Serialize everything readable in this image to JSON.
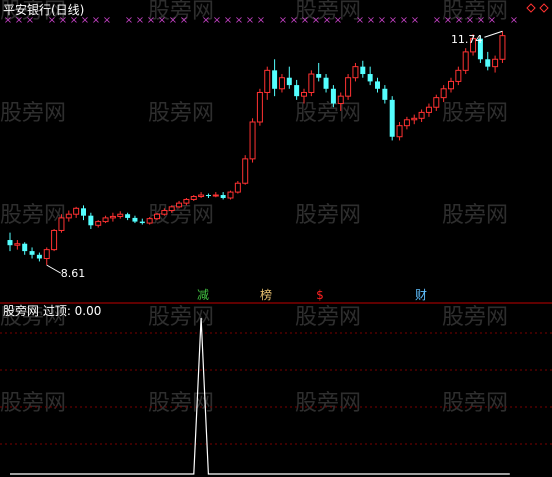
{
  "colors": {
    "background": "#000000",
    "up_candle": "#ff3232",
    "down_candle": "#54ffff",
    "doji": "#ffffff",
    "marker_x": "#c040c0",
    "title_text": "#ffffff",
    "divider": "#c00000",
    "grid": "#7a0000",
    "watermark": "#555555",
    "label_jian": "#40c040",
    "label_bang": "#e8c070",
    "label_s": "#ff2020",
    "label_cai": "#60c0ff",
    "indicator_line": "#ffffff"
  },
  "watermarks": [
    "股旁网",
    "股旁网",
    "股旁网",
    "股旁网",
    "股旁网",
    "股旁网",
    "股旁网",
    "股旁网",
    "股旁网",
    "股旁网",
    "股旁网",
    "股旁网",
    "股旁网",
    "股旁网",
    "股旁网",
    "股旁网",
    "股旁网",
    "股旁网",
    "股旁网",
    "股旁网",
    "股旁网",
    "股旁网",
    "股旁网",
    "股旁网",
    "股旁网",
    "股旁网",
    "股旁网",
    "股旁网",
    "股旁网",
    "股旁网",
    "股旁网",
    "股旁网"
  ],
  "chart_data": [
    {
      "type": "candlestick",
      "title": "平安银行(日线)",
      "low_label": "8.61",
      "high_label": "11.74",
      "ylim": [
        8.3,
        12.0
      ],
      "markers": {
        "symbol": "×",
        "count": 47
      },
      "signal_labels": [
        "减",
        "榜",
        "$",
        "财"
      ],
      "corner_icon": "diamond-icon",
      "ohlc": [
        [
          8.95,
          9.05,
          8.8,
          8.88
        ],
        [
          8.88,
          8.95,
          8.82,
          8.9
        ],
        [
          8.9,
          8.92,
          8.75,
          8.8
        ],
        [
          8.8,
          8.85,
          8.7,
          8.75
        ],
        [
          8.75,
          8.78,
          8.66,
          8.7
        ],
        [
          8.7,
          8.85,
          8.61,
          8.82
        ],
        [
          8.82,
          9.1,
          8.8,
          9.08
        ],
        [
          9.08,
          9.3,
          9.05,
          9.25
        ],
        [
          9.25,
          9.35,
          9.2,
          9.3
        ],
        [
          9.3,
          9.4,
          9.25,
          9.38
        ],
        [
          9.38,
          9.42,
          9.22,
          9.28
        ],
        [
          9.28,
          9.32,
          9.1,
          9.15
        ],
        [
          9.15,
          9.22,
          9.12,
          9.2
        ],
        [
          9.2,
          9.28,
          9.18,
          9.25
        ],
        [
          9.25,
          9.32,
          9.2,
          9.27
        ],
        [
          9.27,
          9.34,
          9.24,
          9.3
        ],
        [
          9.3,
          9.32,
          9.22,
          9.25
        ],
        [
          9.25,
          9.28,
          9.18,
          9.2
        ],
        [
          9.2,
          9.24,
          9.16,
          9.18
        ],
        [
          9.18,
          9.26,
          9.16,
          9.24
        ],
        [
          9.24,
          9.32,
          9.22,
          9.3
        ],
        [
          9.3,
          9.38,
          9.28,
          9.35
        ],
        [
          9.35,
          9.42,
          9.32,
          9.4
        ],
        [
          9.4,
          9.48,
          9.38,
          9.45
        ],
        [
          9.45,
          9.52,
          9.42,
          9.5
        ],
        [
          9.5,
          9.56,
          9.48,
          9.54
        ],
        [
          9.54,
          9.6,
          9.52,
          9.56
        ],
        [
          9.56,
          9.58,
          9.52,
          9.55
        ],
        [
          9.55,
          9.6,
          9.53,
          9.56
        ],
        [
          9.56,
          9.6,
          9.5,
          9.52
        ],
        [
          9.52,
          9.62,
          9.5,
          9.6
        ],
        [
          9.6,
          9.75,
          9.58,
          9.72
        ],
        [
          9.72,
          10.1,
          9.7,
          10.05
        ],
        [
          10.05,
          10.6,
          10.0,
          10.55
        ],
        [
          10.55,
          11.0,
          10.5,
          10.95
        ],
        [
          10.95,
          11.3,
          10.85,
          11.25
        ],
        [
          11.25,
          11.4,
          10.9,
          11.0
        ],
        [
          11.0,
          11.2,
          10.95,
          11.15
        ],
        [
          11.15,
          11.3,
          11.0,
          11.05
        ],
        [
          11.05,
          11.12,
          10.85,
          10.9
        ],
        [
          10.9,
          11.0,
          10.8,
          10.95
        ],
        [
          10.95,
          11.25,
          10.9,
          11.2
        ],
        [
          11.2,
          11.35,
          11.1,
          11.15
        ],
        [
          11.15,
          11.2,
          10.95,
          11.0
        ],
        [
          11.0,
          11.05,
          10.75,
          10.8
        ],
        [
          10.8,
          10.95,
          10.7,
          10.9
        ],
        [
          10.9,
          11.2,
          10.85,
          11.15
        ],
        [
          11.15,
          11.35,
          11.1,
          11.3
        ],
        [
          11.3,
          11.38,
          11.15,
          11.2
        ],
        [
          11.2,
          11.3,
          11.05,
          11.1
        ],
        [
          11.1,
          11.15,
          10.95,
          11.0
        ],
        [
          11.0,
          11.05,
          10.8,
          10.85
        ],
        [
          10.85,
          10.9,
          10.3,
          10.35
        ],
        [
          10.35,
          10.55,
          10.3,
          10.5
        ],
        [
          10.5,
          10.62,
          10.45,
          10.58
        ],
        [
          10.58,
          10.65,
          10.52,
          10.6
        ],
        [
          10.6,
          10.72,
          10.55,
          10.68
        ],
        [
          10.68,
          10.8,
          10.62,
          10.75
        ],
        [
          10.75,
          10.92,
          10.7,
          10.88
        ],
        [
          10.88,
          11.05,
          10.82,
          11.0
        ],
        [
          11.0,
          11.15,
          10.95,
          11.1
        ],
        [
          11.1,
          11.3,
          11.05,
          11.25
        ],
        [
          11.25,
          11.55,
          11.2,
          11.5
        ],
        [
          11.5,
          11.74,
          11.45,
          11.68
        ],
        [
          11.68,
          11.72,
          11.35,
          11.4
        ],
        [
          11.4,
          11.5,
          11.25,
          11.3
        ],
        [
          11.3,
          11.45,
          11.22,
          11.4
        ],
        [
          11.4,
          11.78,
          11.35,
          11.72
        ]
      ]
    },
    {
      "type": "line",
      "title": "股旁网 过顶: 0.00",
      "ylim": [
        0,
        1
      ],
      "values": [
        0,
        0,
        0,
        0,
        0,
        0,
        0,
        0,
        0,
        0,
        0,
        0,
        0,
        0,
        0,
        0,
        0,
        0,
        0,
        0,
        0,
        0,
        0,
        0,
        0,
        0,
        0,
        0,
        0,
        0,
        0,
        0,
        0,
        0,
        0,
        0,
        0,
        0,
        0,
        0,
        0,
        0,
        0,
        0,
        0,
        0,
        0,
        0,
        0,
        0,
        0,
        0,
        0,
        0,
        0,
        0,
        0,
        0,
        0,
        0,
        0,
        0,
        0,
        0,
        0,
        0,
        0,
        0
      ],
      "spike": {
        "index": 26,
        "value": 1
      }
    }
  ]
}
